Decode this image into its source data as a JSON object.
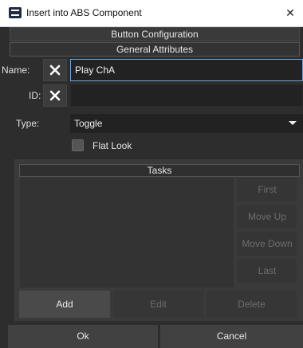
{
  "window": {
    "title": "Insert into ABS Component",
    "close_glyph": "✕"
  },
  "sections": {
    "button_configuration": "Button Configuration",
    "general_attributes": "General Attributes"
  },
  "fields": {
    "name_label": "Name:",
    "name_value": "Play ChA",
    "id_label": "ID:",
    "id_value": "",
    "type_label": "Type:",
    "type_value": "Toggle",
    "flat_look_label": "Flat Look",
    "flat_look_checked": false
  },
  "tasks": {
    "header": "Tasks",
    "items": [],
    "side_buttons": [
      "First",
      "Move Up",
      "Move Down",
      "Last"
    ],
    "add_label": "Add",
    "edit_label": "Edit",
    "delete_label": "Delete"
  },
  "footer": {
    "ok_label": "Ok",
    "cancel_label": "Cancel"
  },
  "icons": {
    "clear": "close-x-icon",
    "dropdown": "triangle-down-icon"
  },
  "colors": {
    "background": "#2d2d2d",
    "field_focus_border": "#6aa5d8"
  }
}
